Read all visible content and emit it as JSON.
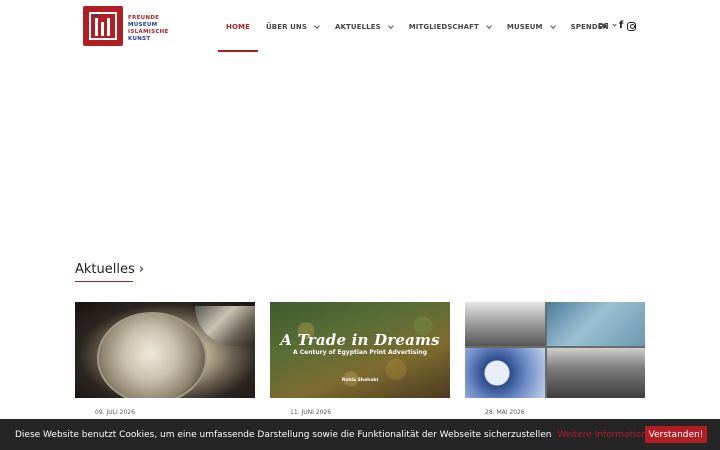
{
  "brand": {
    "lines": [
      "FREUNDE",
      "MUSEUM",
      "ISLAMISCHE",
      "KUNST"
    ],
    "colors": {
      "primary": "#b01e23",
      "secondary": "#1c3c8c"
    }
  },
  "nav": {
    "items": [
      {
        "label": "HOME",
        "active": true
      },
      {
        "label": "ÜBER UNS",
        "dropdown": true
      },
      {
        "label": "AKTUELLES",
        "dropdown": true
      },
      {
        "label": "MITGLIEDSCHAFT",
        "dropdown": true
      },
      {
        "label": "MUSEUM",
        "dropdown": true
      },
      {
        "label": "SPENDEN"
      }
    ],
    "language": "DE",
    "social": [
      {
        "icon": "facebook-icon"
      },
      {
        "icon": "instagram-icon"
      }
    ]
  },
  "news": {
    "title": "Aktuelles ›",
    "cards": [
      {
        "date": "09. JULI 2026",
        "image": "silver-bowl-photo"
      },
      {
        "date": "11. JUNI 2026",
        "image": "book-cover",
        "cover_title": "A Trade in Dreams",
        "cover_subtitle": "A Century of Egyptian Print Advertising",
        "cover_author": "Rahia Shehabi"
      },
      {
        "date": "28. MAI 2026",
        "image": "museum-collage"
      }
    ]
  },
  "cookie": {
    "text": "Diese Website benutzt Cookies, um eine umfassende Darstellung sowie die Funktionalität der Webseite sicherzustellen",
    "link": "Weitere Informationen",
    "button": "Verstanden!"
  }
}
